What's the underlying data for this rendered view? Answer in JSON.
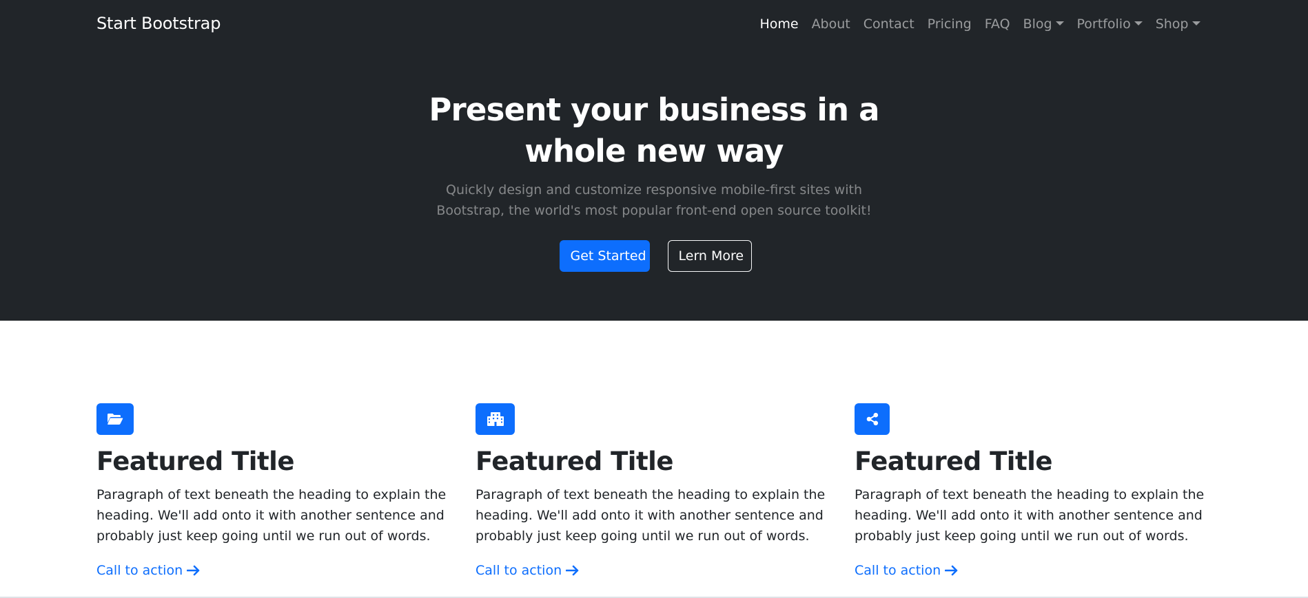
{
  "navbar": {
    "brand": "Start Bootstrap",
    "items": [
      {
        "label": "Home",
        "active": true,
        "dropdown": false
      },
      {
        "label": "About",
        "active": false,
        "dropdown": false
      },
      {
        "label": "Contact",
        "active": false,
        "dropdown": false
      },
      {
        "label": "Pricing",
        "active": false,
        "dropdown": false
      },
      {
        "label": "FAQ",
        "active": false,
        "dropdown": false
      },
      {
        "label": "Blog",
        "active": false,
        "dropdown": true
      },
      {
        "label": "Portfolio",
        "active": false,
        "dropdown": true
      },
      {
        "label": "Shop",
        "active": false,
        "dropdown": true
      }
    ]
  },
  "hero": {
    "title_line1": "Present your business in a",
    "title_line2": "whole new way",
    "lead_line1": "Quickly design and customize responsive mobile-first sites with",
    "lead_line2": "Bootstrap, the world's most popular front-end open source toolkit!",
    "primary_button": "Get Started",
    "secondary_button": "Lern More"
  },
  "features": [
    {
      "icon": "folder-open-icon",
      "title": "Featured Title",
      "text_line1": "Paragraph of text beneath the heading to explain the",
      "text_line2": "heading. We'll add onto it with another sentence and",
      "text_line3": "probably just keep going until we run out of words.",
      "link": "Call to action"
    },
    {
      "icon": "building-icon",
      "title": "Featured Title",
      "text_line1": "Paragraph of text beneath the heading to explain the",
      "text_line2": "heading. We'll add onto it with another sentence and",
      "text_line3": "probably just keep going until we run out of words.",
      "link": "Call to action"
    },
    {
      "icon": "share-icon",
      "title": "Featured Title",
      "text_line1": "Paragraph of text beneath the heading to explain the",
      "text_line2": "heading. We'll add onto it with another sentence and",
      "text_line3": "probably just keep going until we run out of words.",
      "link": "Call to action"
    }
  ],
  "colors": {
    "dark": "#212529",
    "primary": "#0d6efd",
    "white": "#ffffff"
  }
}
